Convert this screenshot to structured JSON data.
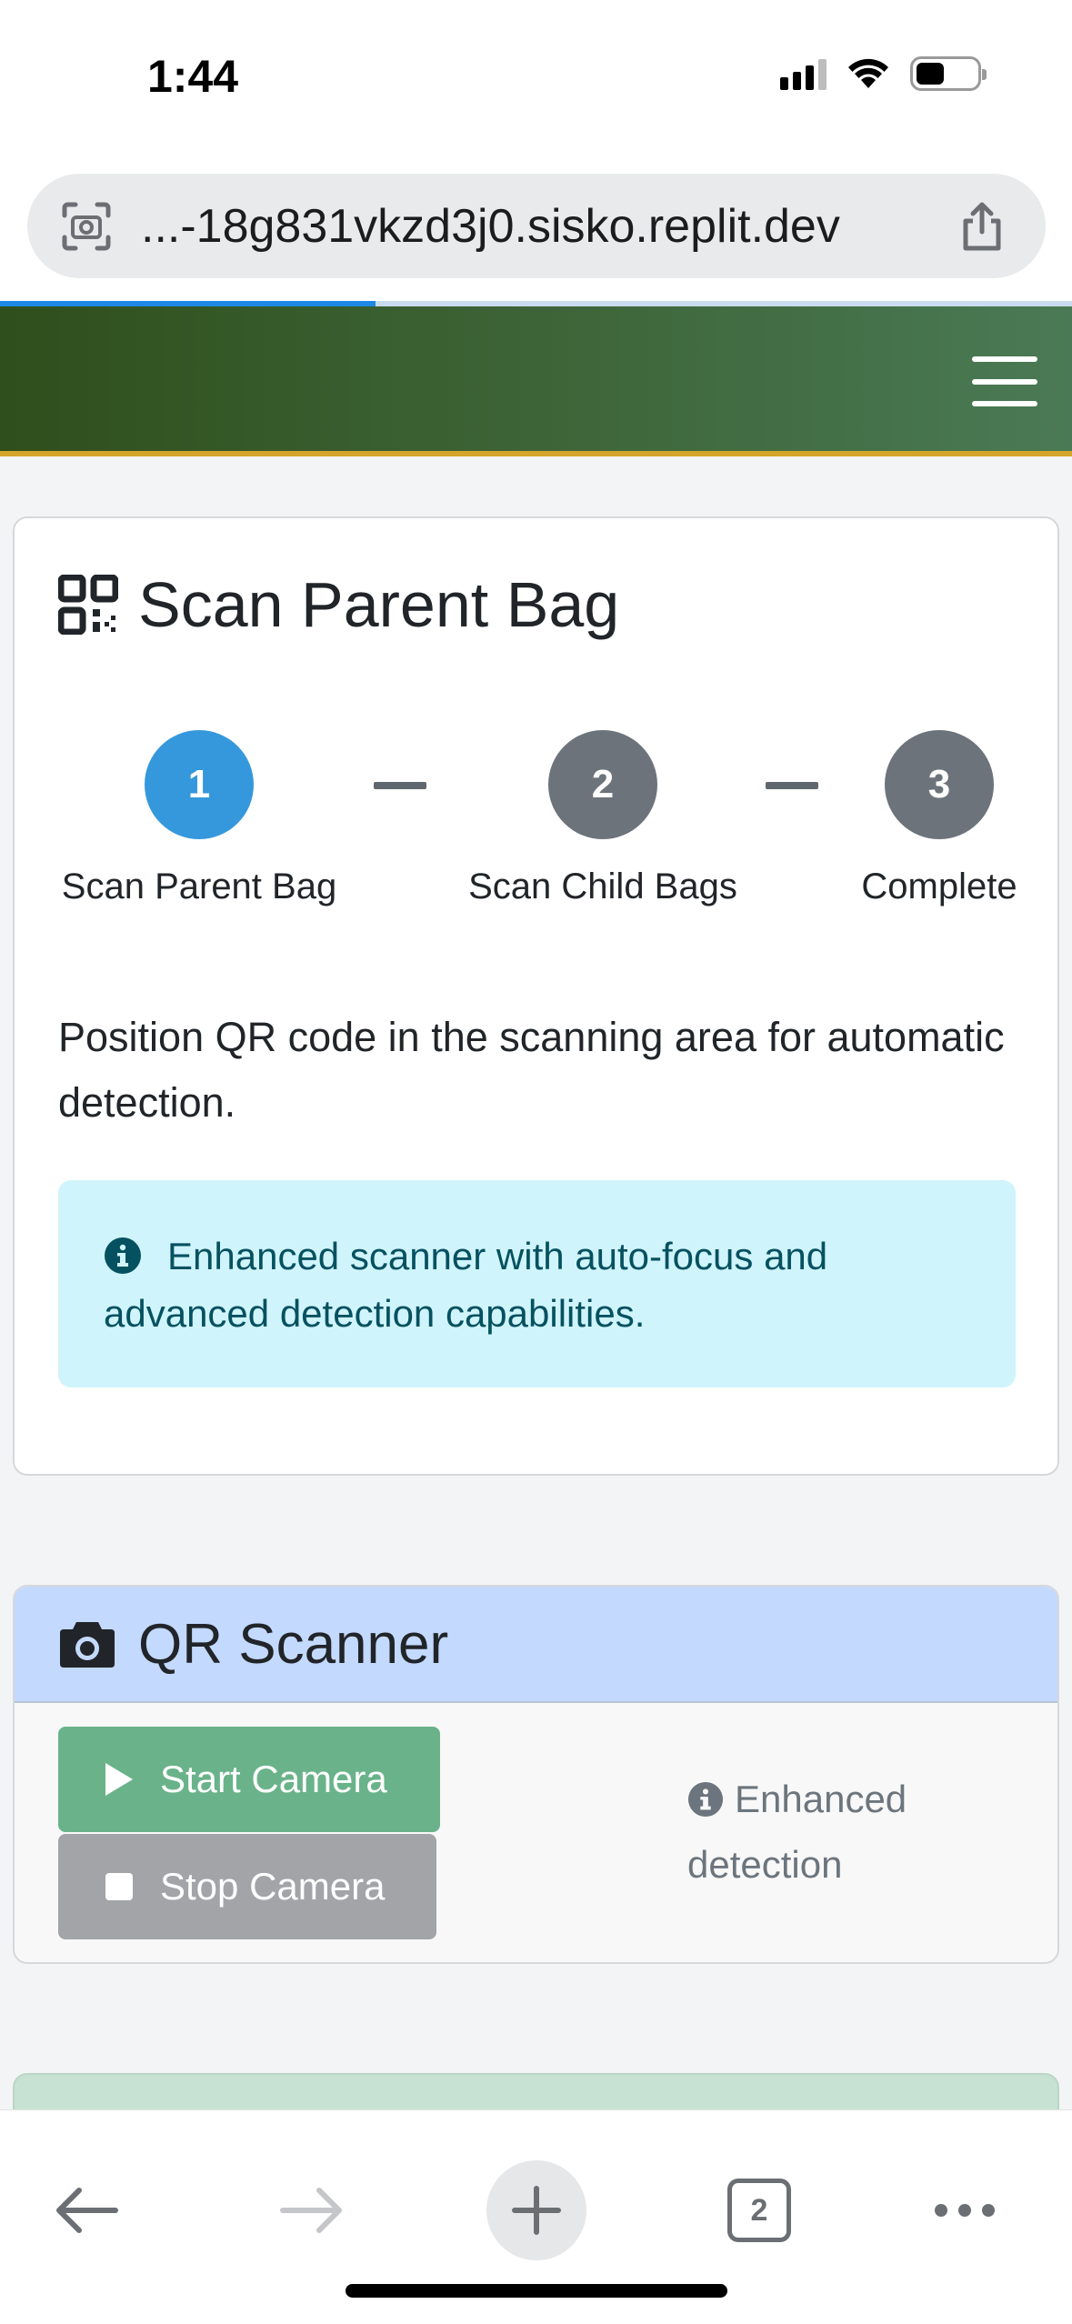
{
  "status_bar": {
    "time": "1:44"
  },
  "browser": {
    "url": "...-18g831vkzd3j0.sisko.replit.dev",
    "load_progress": 0.35,
    "open_tabs": "2"
  },
  "main_card": {
    "title": "Scan Parent Bag",
    "steps": [
      {
        "number": "1",
        "label": "Scan Parent Bag",
        "state": "active"
      },
      {
        "number": "2",
        "label": "Scan Child Bags",
        "state": "inactive"
      },
      {
        "number": "3",
        "label": "Complete",
        "state": "inactive"
      }
    ],
    "instruction": "Position QR code in the scanning area for automatic detection.",
    "alert": "Enhanced scanner with auto-focus and advanced detection capabilities."
  },
  "scanner_card": {
    "title": "QR Scanner",
    "start_button": "Start Camera",
    "stop_button": "Stop Camera",
    "note": "Enhanced detection"
  },
  "colors": {
    "navbar_start": "#2f4f1c",
    "navbar_end": "#4a7a55",
    "navbar_accent": "#d4a52a",
    "step_active": "#3598dc",
    "step_inactive": "#6c737b",
    "alert_bg": "#cff4fc",
    "start_button": "#6ab38a",
    "stop_button": "#a2a4a8",
    "scanner_header": "#c3d9fd"
  },
  "icons": {
    "url_left": "camera-scan-icon",
    "url_right": "share-icon",
    "title": "qrcode-icon",
    "scanner_title": "camera-icon",
    "info": "info-circle-icon",
    "start": "play-icon",
    "stop": "stop-icon"
  }
}
